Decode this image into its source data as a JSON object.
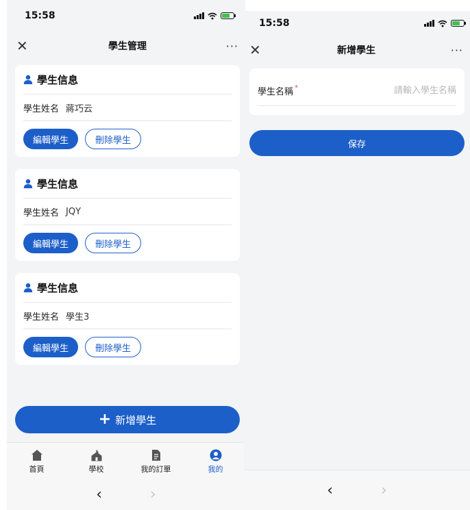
{
  "left": {
    "status": {
      "time": "15:58"
    },
    "nav": {
      "title": "學生管理",
      "close": "✕",
      "more": "···"
    },
    "students": [
      {
        "header": "學生信息",
        "name_label": "學生姓名",
        "name": "蔣巧云",
        "edit": "編輯學生",
        "delete": "刪除學生"
      },
      {
        "header": "學生信息",
        "name_label": "學生姓名",
        "name": "JQY",
        "edit": "編輯學生",
        "delete": "刪除學生"
      },
      {
        "header": "學生信息",
        "name_label": "學生姓名",
        "name": "學生3",
        "edit": "編輯學生",
        "delete": "刪除學生"
      }
    ],
    "add_button": "新增學生",
    "tabs": [
      {
        "label": "首頁",
        "icon": "home-icon"
      },
      {
        "label": "學校",
        "icon": "school-icon"
      },
      {
        "label": "我的訂單",
        "icon": "orders-icon"
      },
      {
        "label": "我的",
        "icon": "profile-icon",
        "active": true
      }
    ]
  },
  "right": {
    "status": {
      "time": "15:58"
    },
    "nav": {
      "title": "新增學生",
      "close": "✕",
      "more": "···"
    },
    "form": {
      "label": "學生名稱",
      "required_mark": "*",
      "placeholder": "請輸入學生名稱"
    },
    "save_button": "保存"
  },
  "colors": {
    "primary": "#1d5fc9",
    "background": "#f3f4f6",
    "required": "#e94040"
  }
}
